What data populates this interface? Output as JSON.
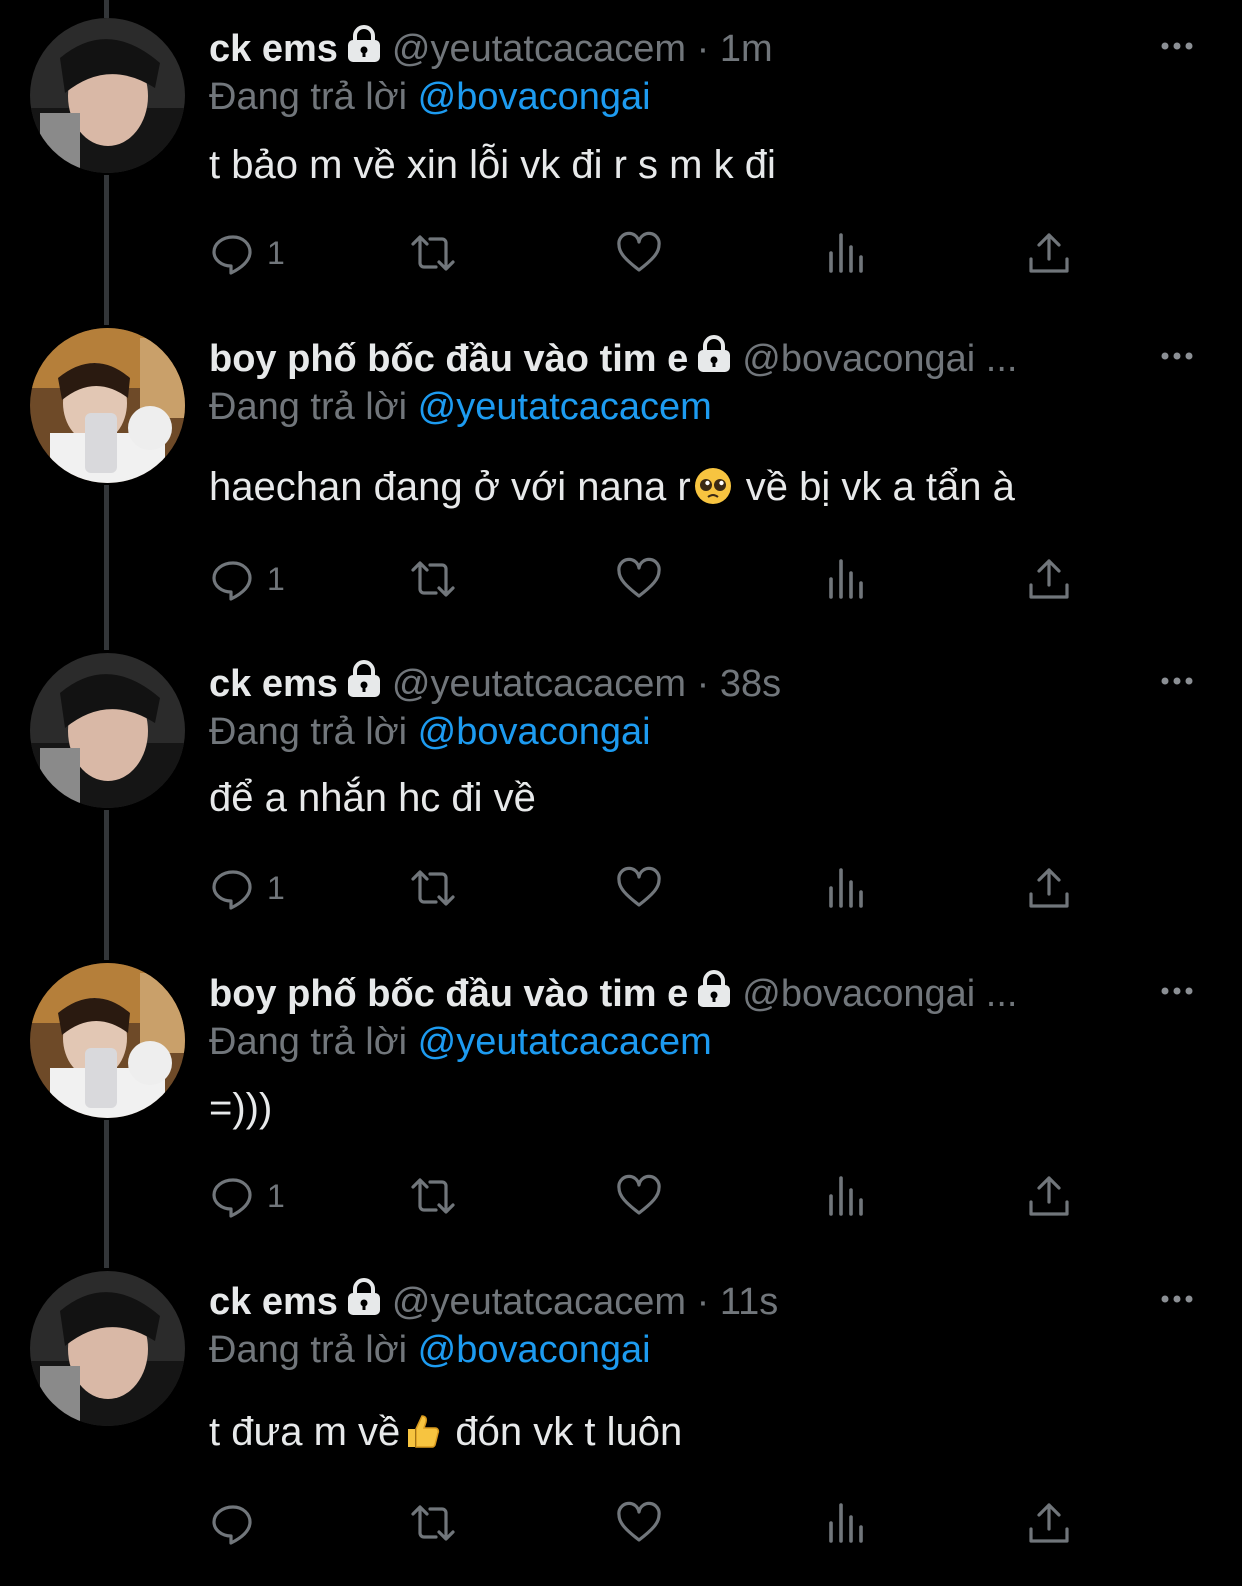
{
  "tweets": [
    {
      "name": "ck ems",
      "handle": "@yeutatcacacem",
      "sep": "·",
      "time": "1m",
      "reply_prefix": "Đang trả lời",
      "reply_to": "@bovacongai",
      "text_before": "t bảo m về xin lỗi vk đi r s m k đi",
      "emoji": "",
      "text_after": "",
      "reply_count": "1"
    },
    {
      "name": "boy phố bốc đầu vào tim e",
      "handle": "@bovacongai ...",
      "sep": "",
      "time": "",
      "reply_prefix": "Đang trả lời",
      "reply_to": "@yeutatcacacem",
      "text_before": "haechan đang ở với nana r",
      "emoji": "pleading-face-emoji",
      "text_after": " về bị vk a tẩn à",
      "reply_count": "1"
    },
    {
      "name": "ck ems",
      "handle": "@yeutatcacacem",
      "sep": "·",
      "time": "38s",
      "reply_prefix": "Đang trả lời",
      "reply_to": "@bovacongai",
      "text_before": "để a nhắn hc đi về",
      "emoji": "",
      "text_after": "",
      "reply_count": "1"
    },
    {
      "name": "boy phố bốc đầu vào tim e",
      "handle": "@bovacongai ...",
      "sep": "",
      "time": "",
      "reply_prefix": "Đang trả lời",
      "reply_to": "@yeutatcacacem",
      "text_before": "=)))",
      "emoji": "",
      "text_after": "",
      "reply_count": "1"
    },
    {
      "name": "ck ems",
      "handle": "@yeutatcacacem",
      "sep": "·",
      "time": "11s",
      "reply_prefix": "Đang trả lời",
      "reply_to": "@bovacongai",
      "text_before": "t đưa m về",
      "emoji": "thumbs-up-emoji",
      "text_after": " đón vk t luôn",
      "reply_count": ""
    }
  ],
  "colors": {
    "accent": "#1d9bf0",
    "muted": "#71767b",
    "text": "#e7e9ea",
    "background": "#000000",
    "thread_line": "#333639"
  }
}
